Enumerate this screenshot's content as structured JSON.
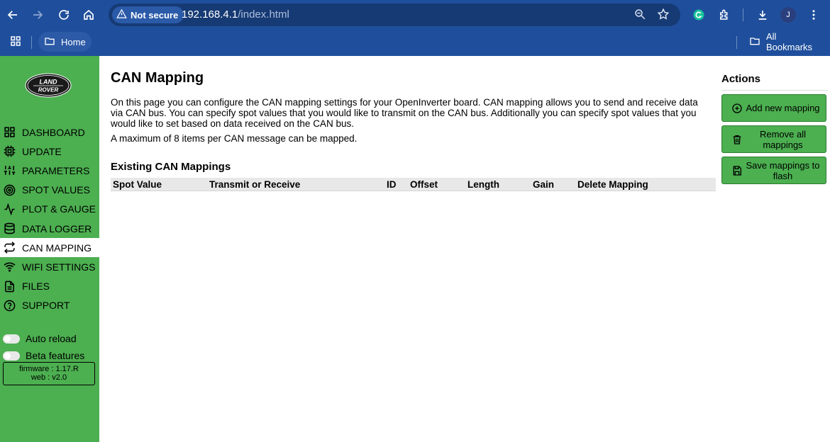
{
  "browser": {
    "security_label": "Not secure",
    "url_host": "192.168.4.1",
    "url_path": "/index.html",
    "profile_initial": "J",
    "bookmarks": {
      "home": "Home",
      "all": "All Bookmarks"
    }
  },
  "sidebar": {
    "logo": {
      "line1": "LAND",
      "line2": "ROVER"
    },
    "items": [
      {
        "label": "DASHBOARD",
        "icon": "dashboard-icon"
      },
      {
        "label": "UPDATE",
        "icon": "chip-icon"
      },
      {
        "label": "PARAMETERS",
        "icon": "sliders-icon"
      },
      {
        "label": "SPOT VALUES",
        "icon": "target-icon"
      },
      {
        "label": "PLOT & GAUGE",
        "icon": "activity-icon"
      },
      {
        "label": "DATA LOGGER",
        "icon": "database-icon"
      },
      {
        "label": "CAN MAPPING",
        "icon": "repeat-icon",
        "active": true
      },
      {
        "label": "WIFI SETTINGS",
        "icon": "wifi-icon"
      },
      {
        "label": "FILES",
        "icon": "file-icon"
      },
      {
        "label": "SUPPORT",
        "icon": "help-icon"
      }
    ],
    "auto_reload": "Auto reload",
    "beta_features": "Beta features",
    "firmware": "firmware : 1.17.R",
    "web": "web : v2.0"
  },
  "main": {
    "title": "CAN Mapping",
    "intro": "On this page you can configure the CAN mapping settings for your OpenInverter board. CAN mapping allows you to send and receive data via CAN bus. You can specify spot values that you would like to transmit on the CAN bus. Additionally you can specify spot values that you would like to set based on data received on the CAN bus.",
    "note": "A maximum of 8 items per CAN message can be mapped.",
    "section_title": "Existing CAN Mappings",
    "columns": [
      "Spot Value",
      "Transmit or Receive",
      "ID",
      "Offset",
      "Length",
      "Gain",
      "Delete Mapping"
    ]
  },
  "actions": {
    "title": "Actions",
    "add": "Add new mapping",
    "remove": "Remove all mappings",
    "save": "Save mappings to flash"
  },
  "colors": {
    "chrome": "#1f4f9c",
    "sidebar": "#4caf50",
    "button": "#4caf50"
  }
}
